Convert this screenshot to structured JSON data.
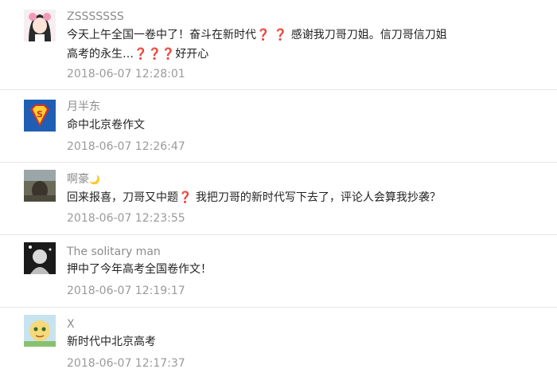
{
  "comments": [
    {
      "user": "ZSSSSSSS",
      "text_part1": "今天上午全国一卷中了！奋斗在新时代",
      "text_part2": "感谢我刀哥刀姐。信刀哥信刀姐",
      "text_part3": "高考的永生…",
      "text_part4": "好开心",
      "question_mark": "❓",
      "time": "2018-06-07 12:28:01",
      "avatar": "anime-girl-avatar"
    },
    {
      "user": "月半东",
      "text": "命中北京卷作文",
      "time": "2018-06-07 12:26:47",
      "avatar": "superman-logo-avatar"
    },
    {
      "user": "啊豪",
      "user_suffix": "🌙",
      "text_part1": "回来报喜，刀哥又中题",
      "text_part2": "我把刀哥的新时代写下去了，评论人会算我抄袭？",
      "question_mark": "❓",
      "time": "2018-06-07 12:23:55",
      "avatar": "photo-avatar"
    },
    {
      "user": "The solitary man",
      "text": "押中了今年高考全国卷作文！",
      "time": "2018-06-07 12:19:17",
      "avatar": "bw-photo-avatar"
    },
    {
      "user": "X",
      "text": "新时代中北京高考",
      "time": "2018-06-07 12:17:37",
      "avatar": "cartoon-avatar"
    }
  ]
}
